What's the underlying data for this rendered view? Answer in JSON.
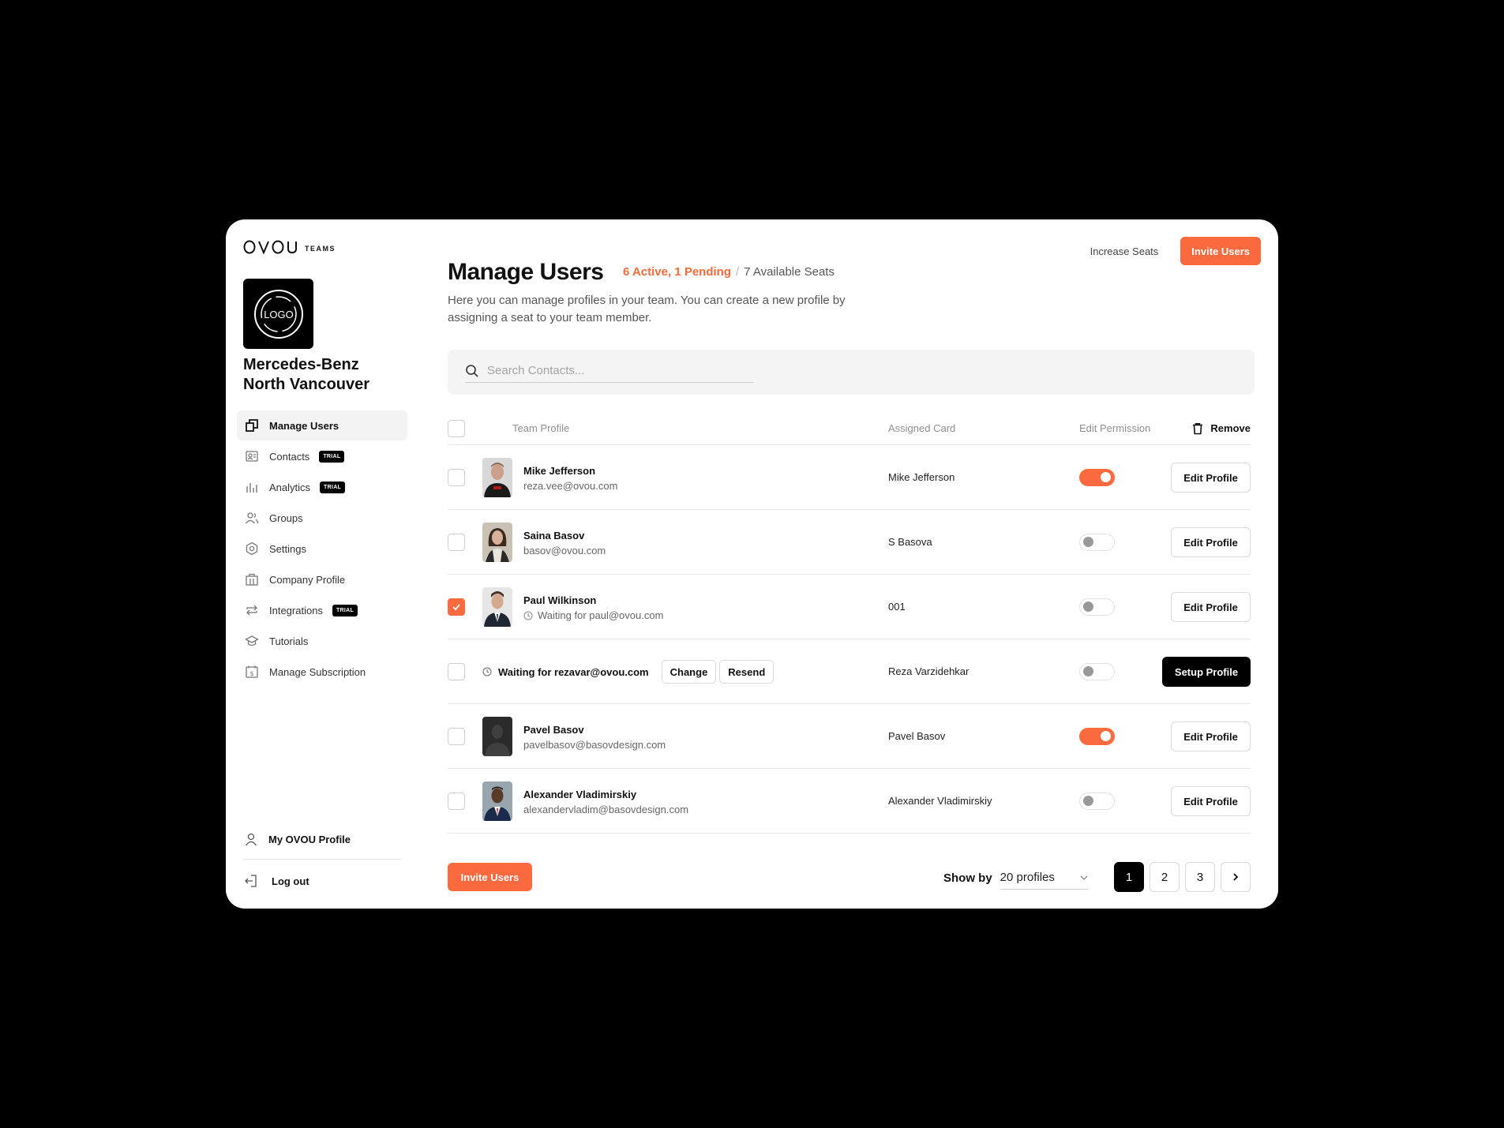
{
  "brand": {
    "mark": "OVOU",
    "sub": "TEAMS"
  },
  "company": {
    "logo_text": "LOGO",
    "name": "Mercedes-Benz North Vancouver"
  },
  "sidebar": {
    "items": [
      {
        "label": "Manage Users",
        "icon": "users-square-icon",
        "active": true
      },
      {
        "label": "Contacts",
        "icon": "contacts-icon",
        "badge": "TRIAL"
      },
      {
        "label": "Analytics",
        "icon": "bar-chart-icon",
        "badge": "TRIAL"
      },
      {
        "label": "Groups",
        "icon": "group-icon"
      },
      {
        "label": "Settings",
        "icon": "gear-icon"
      },
      {
        "label": "Company Profile",
        "icon": "building-icon"
      },
      {
        "label": "Integrations",
        "icon": "swap-icon",
        "badge": "TRIAL"
      },
      {
        "label": "Tutorials",
        "icon": "graduation-cap-icon"
      },
      {
        "label": "Manage Subscription",
        "icon": "subscription-icon"
      }
    ],
    "my_profile": "My OVOU Profile",
    "logout": "Log out"
  },
  "header": {
    "title": "Manage Users",
    "active_pending": "6 Active, 1 Pending",
    "separator": "/",
    "available": "7 Available Seats",
    "subtitle": "Here you can manage profiles in your team. You can create a new profile by assigning a seat to your team member.",
    "increase_seats": "Increase Seats",
    "invite_users": "Invite Users"
  },
  "search": {
    "placeholder": "Search Contacts..."
  },
  "table": {
    "headers": {
      "team_profile": "Team Profile",
      "assigned_card": "Assigned Card",
      "edit_permission": "Edit Permission",
      "remove": "Remove"
    },
    "edit_label": "Edit Profile",
    "setup_label": "Setup Profile",
    "change_label": "Change",
    "resend_label": "Resend",
    "rows": [
      {
        "name": "Mike Jefferson",
        "email": "reza.vee@ovou.com",
        "card": "Mike Jefferson",
        "permission": true
      },
      {
        "name": "Saina Basov",
        "email": "basov@ovou.com",
        "card": "S Basova",
        "permission": false
      },
      {
        "name": "Paul Wilkinson",
        "email": "Waiting for paul@ovou.com",
        "card": "001",
        "permission": false,
        "checked": true
      },
      {
        "pending": "Waiting for rezavar@ovou.com",
        "card": "Reza Varzidehkar",
        "permission": false
      },
      {
        "name": "Pavel Basov",
        "email": "pavelbasov@basovdesign.com",
        "card": "Pavel Basov",
        "permission": true
      },
      {
        "name": "Alexander Vladimirskiy",
        "email": "alexandervladim@basovdesign.com",
        "card": "Alexander Vladimirskiy",
        "permission": false
      }
    ]
  },
  "footer": {
    "invite_users": "Invite Users",
    "show_by_label": "Show by",
    "show_by_value": "20 profiles",
    "pages": [
      "1",
      "2",
      "3"
    ],
    "current_page": "1"
  },
  "colors": {
    "accent": "#fb6a3e",
    "dark": "#000000"
  }
}
